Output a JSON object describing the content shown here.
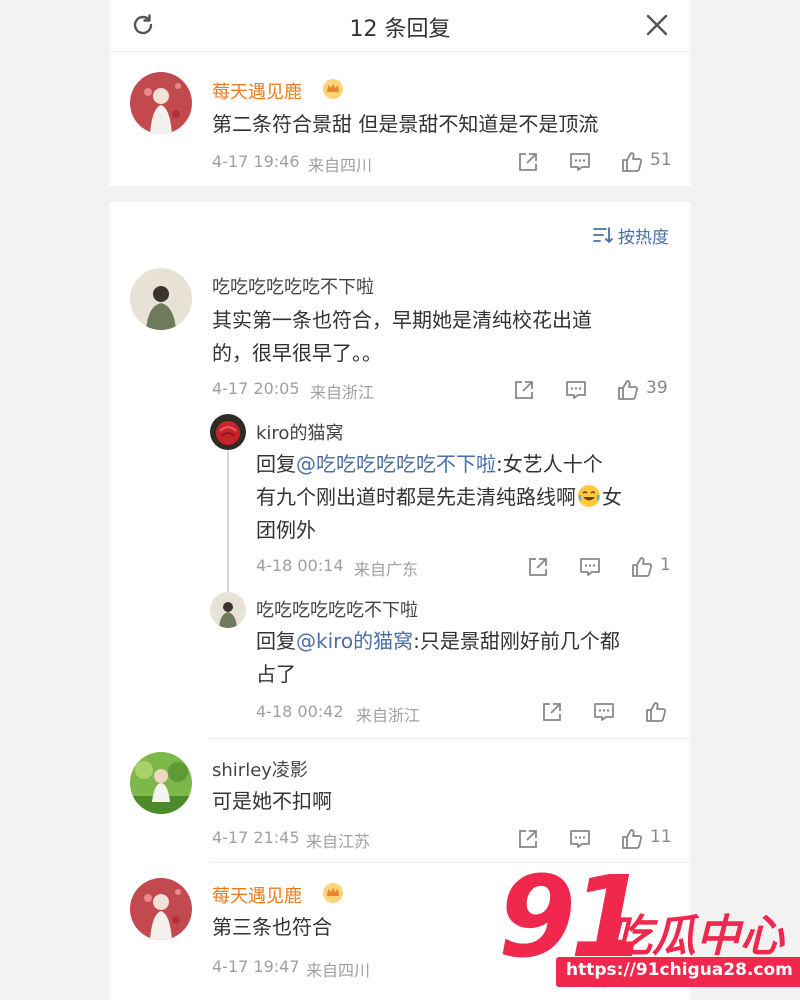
{
  "header": {
    "title": "12 条回复"
  },
  "sort": {
    "label": "按热度"
  },
  "root": {
    "user": "莓天遇见鹿",
    "text": "第二条符合景甜 但是景甜不知道是不是顶流",
    "time": "4-17 19:46",
    "from": "来自四川",
    "likes": "51"
  },
  "comments": [
    {
      "user": "吃吃吃吃吃吃不下啦",
      "lines": [
        "其实第一条也符合，早期她是清纯校花出道",
        "的，很早很早了。。"
      ],
      "time": "4-17 20:05",
      "from": "来自浙江",
      "likes": "39",
      "replies": [
        {
          "user": "kiro的猫窝",
          "prefix": "回复",
          "mention": "@吃吃吃吃吃吃不下啦",
          "line1_rest": ":女艺人十个",
          "line2": "有九个刚出道时都是先走清纯路线啊",
          "line2_tail": "女",
          "line3": "团例外",
          "time": "4-18 00:14",
          "from": "来自广东",
          "likes": "1"
        },
        {
          "user": "吃吃吃吃吃吃不下啦",
          "prefix": "回复",
          "mention": "@kiro的猫窝",
          "line1_rest": ":只是景甜刚好前几个都",
          "line2": "占了",
          "time": "4-18 00:42",
          "from": "来自浙江",
          "likes": ""
        }
      ]
    },
    {
      "user": "shirley凌影",
      "lines": [
        "可是她不扣啊"
      ],
      "time": "4-17 21:45",
      "from": "来自江苏",
      "likes": "11"
    },
    {
      "user": "莓天遇见鹿",
      "lines": [
        "第三条也符合"
      ],
      "time": "4-17 19:47",
      "from": "来自四川",
      "likes": ""
    }
  ],
  "watermark": {
    "number": "91",
    "text": "吃瓜中心",
    "url": "https://91chigua28.com"
  },
  "colors": {
    "accent_orange": "#f07a1e",
    "link_blue": "#4a6ea5",
    "watermark_red": "#f0284e"
  }
}
